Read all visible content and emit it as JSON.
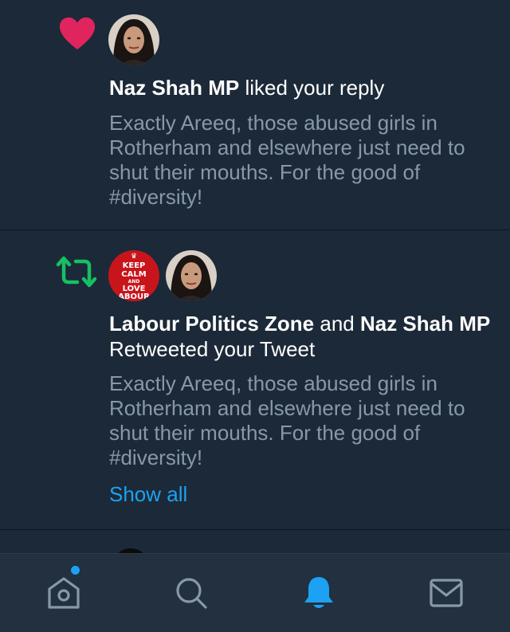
{
  "notifications": [
    {
      "type": "like",
      "icon": "heart-icon",
      "color": "#e0245e",
      "actor_1": "Naz Shah MP",
      "action": " liked your reply",
      "text": "Exactly Areeq, those abused girls in Rotherham and elsewhere just need to shut their mouths. For the good of #diversity!"
    },
    {
      "type": "retweet",
      "icon": "retweet-icon",
      "color": "#17bf63",
      "actor_1": "Labour Politics Zone",
      "connector": " and ",
      "actor_2": "Naz Shah MP",
      "action": " Retweeted your Tweet",
      "text": "Exactly Areeq, those abused girls in Rotherham and elsewhere just need to shut their mouths. For the good of #diversity!",
      "show_all": "Show all",
      "avatar_text": [
        "KEEP",
        "CALM",
        "AND",
        "LOVE",
        "ABOUR"
      ]
    }
  ],
  "tabbar": {
    "tabs": [
      {
        "name": "home",
        "icon": "home-icon",
        "has_badge": true
      },
      {
        "name": "search",
        "icon": "search-icon"
      },
      {
        "name": "notifications",
        "icon": "bell-icon",
        "active": true
      },
      {
        "name": "messages",
        "icon": "mail-icon"
      }
    ],
    "active_color": "#1da1f2",
    "inactive_color": "#8899a6"
  }
}
